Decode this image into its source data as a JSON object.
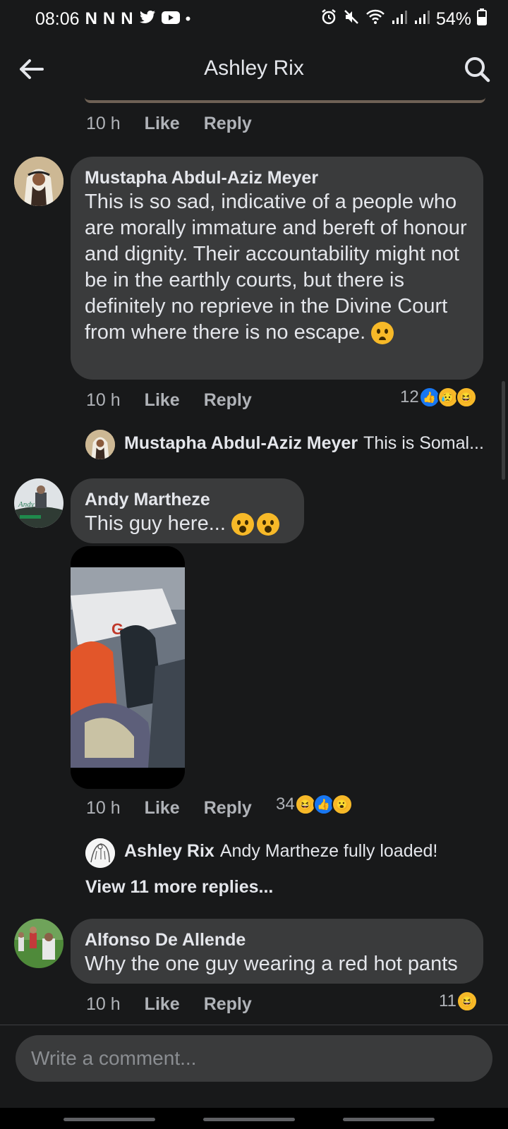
{
  "status_bar": {
    "time": "08:06",
    "notif_icons": [
      "N",
      "N",
      "N"
    ],
    "battery": "54%"
  },
  "header": {
    "title": "Ashley Rix"
  },
  "comments": [
    {
      "time": "10 h",
      "like_label": "Like",
      "reply_label": "Reply"
    },
    {
      "author": "Mustapha Abdul-Aziz Meyer",
      "text": "This is so sad, indicative of a people who are morally immature and bereft of honour and dignity. Their accountability might not be in the earthly courts, but there is definitely no reprieve in the Divine Court from where there is no escape.",
      "time": "10 h",
      "like_label": "Like",
      "reply_label": "Reply",
      "reaction_count": "12",
      "reply_preview": {
        "author": "Mustapha Abdul-Aziz Meyer",
        "text": "This is Somal..."
      }
    },
    {
      "author": "Andy Martheze",
      "text": "This guy here...",
      "time": "10 h",
      "like_label": "Like",
      "reply_label": "Reply",
      "reaction_count": "34",
      "reply_preview": {
        "author": "Ashley Rix",
        "text": "Andy Martheze fully loaded!"
      },
      "view_more": "View 11 more replies..."
    },
    {
      "author": "Alfonso De Allende",
      "text": "Why the one guy wearing a red hot pants",
      "time": "10 h",
      "like_label": "Like",
      "reply_label": "Reply",
      "reaction_count": "11"
    }
  ],
  "composer": {
    "placeholder": "Write a comment..."
  },
  "colors": {
    "background": "#18191a",
    "bubble": "#3a3b3c",
    "like_blue": "#1877f2",
    "emoji_yellow": "#f7b928",
    "secondary_text": "#b0b3b8"
  },
  "icons": [
    "back-arrow-icon",
    "search-icon",
    "like-reaction-icon",
    "sad-reaction-icon",
    "haha-reaction-icon",
    "wow-reaction-icon"
  ]
}
